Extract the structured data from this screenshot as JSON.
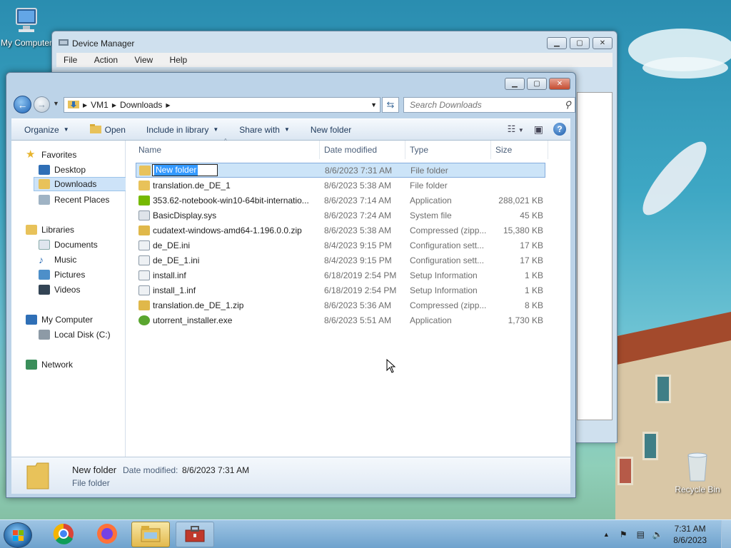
{
  "desktop": {
    "icons": [
      {
        "label": "My Computer"
      },
      {
        "label": "Recycle Bin"
      }
    ]
  },
  "device_manager": {
    "title": "Device Manager",
    "menu": [
      "File",
      "Action",
      "View",
      "Help"
    ]
  },
  "explorer": {
    "breadcrumb": [
      "VM1",
      "Downloads"
    ],
    "search_placeholder": "Search Downloads",
    "toolbar": {
      "organize": "Organize",
      "open": "Open",
      "include_in_library": "Include in library",
      "share_with": "Share with",
      "new_folder": "New folder"
    },
    "nav": {
      "favorites": "Favorites",
      "desktop": "Desktop",
      "downloads": "Downloads",
      "recent_places": "Recent Places",
      "libraries": "Libraries",
      "documents": "Documents",
      "music": "Music",
      "pictures": "Pictures",
      "videos": "Videos",
      "my_computer": "My Computer",
      "local_disk": "Local Disk (C:)",
      "network": "Network"
    },
    "columns": {
      "name": "Name",
      "date": "Date modified",
      "type": "Type",
      "size": "Size"
    },
    "files": [
      {
        "name": "New folder",
        "date": "8/6/2023 7:31 AM",
        "type": "File folder",
        "size": "",
        "icon": "folder-icon",
        "color": "#e8c25a"
      },
      {
        "name": "translation.de_DE_1",
        "date": "8/6/2023 5:38 AM",
        "type": "File folder",
        "size": "",
        "icon": "folder-icon",
        "color": "#e8c25a"
      },
      {
        "name": "353.62-notebook-win10-64bit-internatio...",
        "date": "8/6/2023 7:14 AM",
        "type": "Application",
        "size": "288,021 KB",
        "icon": "nvidia-icon",
        "color": "#76b900"
      },
      {
        "name": "BasicDisplay.sys",
        "date": "8/6/2023 7:24 AM",
        "type": "System file",
        "size": "45 KB",
        "icon": "system-file-icon",
        "color": "#c9d2dc"
      },
      {
        "name": "cudatext-windows-amd64-1.196.0.0.zip",
        "date": "8/6/2023 5:38 AM",
        "type": "Compressed (zipp...",
        "size": "15,380 KB",
        "icon": "zip-folder-icon",
        "color": "#e0b84a"
      },
      {
        "name": "de_DE.ini",
        "date": "8/4/2023 9:15 PM",
        "type": "Configuration sett...",
        "size": "17 KB",
        "icon": "ini-file-icon",
        "color": "#c9d2dc"
      },
      {
        "name": "de_DE_1.ini",
        "date": "8/4/2023 9:15 PM",
        "type": "Configuration sett...",
        "size": "17 KB",
        "icon": "ini-file-icon",
        "color": "#c9d2dc"
      },
      {
        "name": "install.inf",
        "date": "6/18/2019 2:54 PM",
        "type": "Setup Information",
        "size": "1 KB",
        "icon": "inf-file-icon",
        "color": "#c9d2dc"
      },
      {
        "name": "install_1.inf",
        "date": "6/18/2019 2:54 PM",
        "type": "Setup Information",
        "size": "1 KB",
        "icon": "inf-file-icon",
        "color": "#c9d2dc"
      },
      {
        "name": "translation.de_DE_1.zip",
        "date": "8/6/2023 5:36 AM",
        "type": "Compressed (zipp...",
        "size": "8 KB",
        "icon": "zip-folder-icon",
        "color": "#e0b84a"
      },
      {
        "name": "utorrent_installer.exe",
        "date": "8/6/2023 5:51 AM",
        "type": "Application",
        "size": "1,730 KB",
        "icon": "utorrent-icon",
        "color": "#5aa62f"
      }
    ],
    "details": {
      "name": "New folder",
      "date_label": "Date modified:",
      "date_value": "8/6/2023 7:31 AM",
      "type": "File folder"
    }
  },
  "taskbar": {
    "time": "7:31 AM",
    "date": "8/6/2023"
  }
}
